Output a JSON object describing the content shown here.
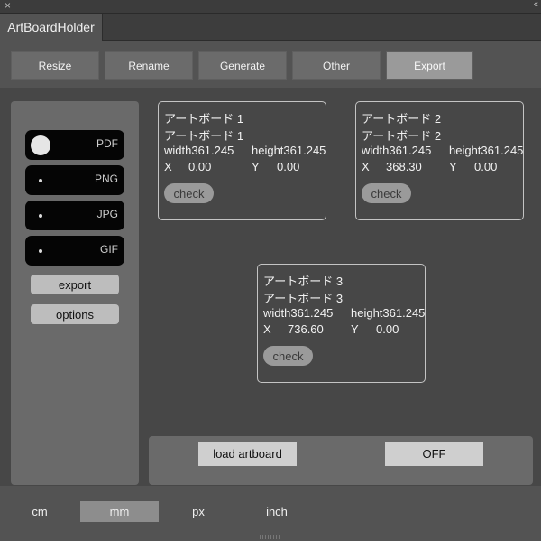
{
  "window": {
    "close_glyph": "×",
    "collapse_glyph": "‹‹",
    "tab_title": "ArtBoardHolder"
  },
  "nav": [
    "Resize",
    "Rename",
    "Generate",
    "Other",
    "Export"
  ],
  "nav_active": "Export",
  "formats": [
    {
      "label": "PDF",
      "on": true
    },
    {
      "label": "PNG",
      "on": false
    },
    {
      "label": "JPG",
      "on": false
    },
    {
      "label": "GIF",
      "on": false
    }
  ],
  "sidebar_buttons": {
    "export": "export",
    "options": "options"
  },
  "artboards": [
    {
      "name1": "アートボード 1",
      "name2": "アートボード 1",
      "width": "width361.245",
      "height": "height361.245",
      "x_label": "X",
      "x_val": "0.00",
      "y_label": "Y",
      "y_val": "0.00",
      "check": "check"
    },
    {
      "name1": "アートボード 2",
      "name2": "アートボード 2",
      "width": "width361.245",
      "height": "height361.245",
      "x_label": "X",
      "x_val": "368.30",
      "y_label": "Y",
      "y_val": "0.00",
      "check": "check"
    },
    {
      "name1": "アートボード 3",
      "name2": "アートボード 3",
      "width": "width361.245",
      "height": "height361.245",
      "x_label": "X",
      "x_val": "736.60",
      "y_label": "Y",
      "y_val": "0.00",
      "check": "check"
    }
  ],
  "bottom": {
    "load": "load artboard",
    "toggle": "OFF"
  },
  "units": [
    "cm",
    "mm",
    "px",
    "inch"
  ],
  "unit_active": "mm",
  "colors": {
    "panel": "#535353",
    "active_nav": "#9a9a9a",
    "switch_bg": "#050505"
  }
}
